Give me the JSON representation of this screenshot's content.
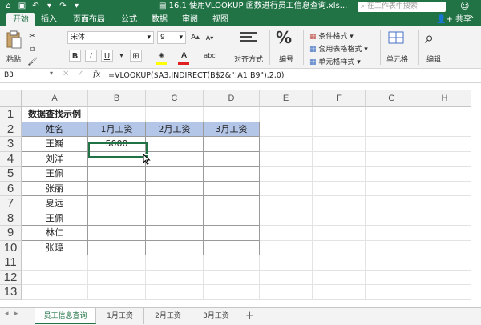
{
  "window": {
    "title": "16.1 使用VLOOKUP 函数进行员工信息查询.xls...",
    "search_placeholder": "在工作表中搜索",
    "share_label": "共享",
    "accent_color": "#217346"
  },
  "tabs": [
    "开始",
    "插入",
    "页面布局",
    "公式",
    "数据",
    "审阅",
    "视图"
  ],
  "ribbon": {
    "paste_label": "粘贴",
    "font_name": "宋体",
    "font_size": "9",
    "bold": "B",
    "italic": "I",
    "underline": "U",
    "align_label": "对齐方式",
    "number_label": "编号",
    "cond_format": "条件格式",
    "table_format": "套用表格格式",
    "cell_style": "单元格样式",
    "cells_label": "单元格",
    "edit_label": "编辑"
  },
  "formula_bar": {
    "name_box": "B3",
    "fx": "fx",
    "formula": "=VLOOKUP($A3,INDIRECT(B$2&\"!A1:B9\"),2,0)"
  },
  "columns": [
    "A",
    "B",
    "C",
    "D",
    "E",
    "F",
    "G",
    "H"
  ],
  "rows": [
    "1",
    "2",
    "3",
    "4",
    "5",
    "6",
    "7",
    "8",
    "9",
    "10",
    "11",
    "12",
    "13"
  ],
  "sheet": {
    "title": "数据查找示例",
    "headers": [
      "姓名",
      "1月工资",
      "2月工资",
      "3月工资"
    ],
    "names": [
      "王巍",
      "刘洋",
      "王佩",
      "张丽",
      "夏远",
      "王佩",
      "林仁",
      "张璋"
    ],
    "b3_value": "5000",
    "header_fill": "#b4c6e7"
  },
  "sheet_tabs": [
    "员工信息查询",
    "1月工资",
    "2月工资",
    "3月工资"
  ],
  "add_sheet": "+"
}
